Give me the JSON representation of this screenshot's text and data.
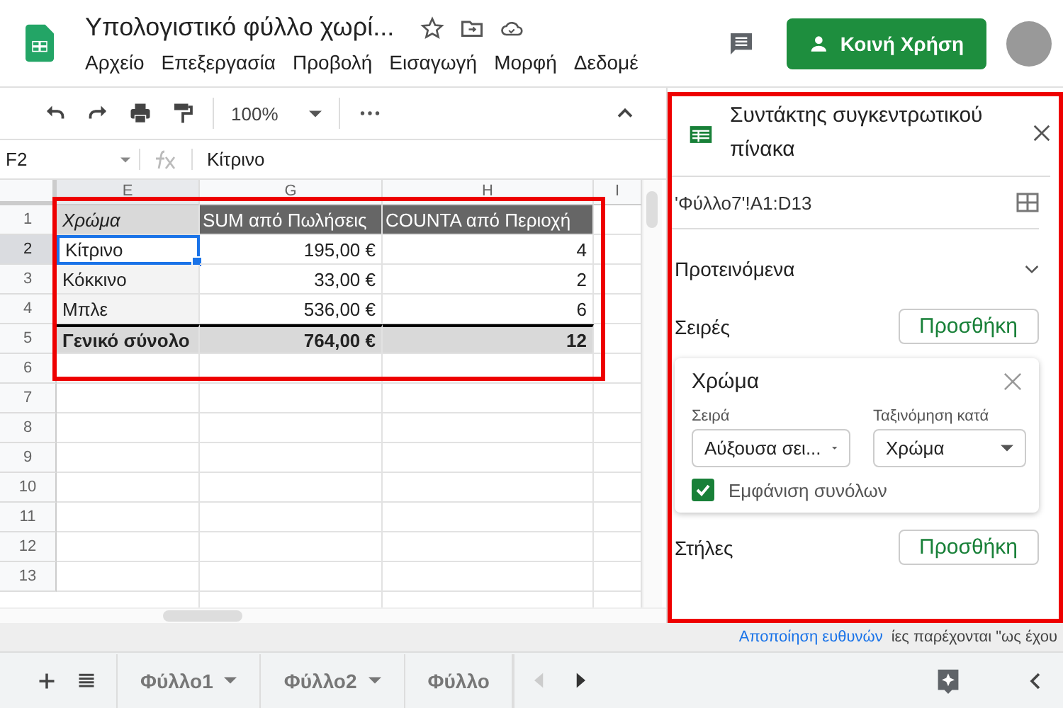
{
  "document": {
    "title": "Υπολογιστικό φύλλο χωρί...",
    "menu": [
      "Αρχείο",
      "Επεξεργασία",
      "Προβολή",
      "Εισαγωγή",
      "Μορφή",
      "Δεδομέ"
    ],
    "share_button": "Κοινή Χρήση"
  },
  "toolbar": {
    "zoom": "100%"
  },
  "formula_bar": {
    "cell": "F2",
    "value": "Κίτρινο"
  },
  "grid": {
    "columns": [
      "E",
      "G",
      "H",
      "I"
    ],
    "rows": [
      {
        "number": "1",
        "kind": "header",
        "selected": false,
        "cells": [
          "Χρώμα",
          "SUM από Πωλήσεις",
          "COUNTA από Περιοχή"
        ]
      },
      {
        "number": "2",
        "kind": "data",
        "selected": true,
        "cells": [
          "Κίτρινο",
          "195,00 €",
          "4"
        ]
      },
      {
        "number": "3",
        "kind": "data",
        "selected": false,
        "cells": [
          "Κόκκινο",
          "33,00 €",
          "2"
        ]
      },
      {
        "number": "4",
        "kind": "data",
        "selected": false,
        "cells": [
          "Μπλε",
          "536,00 €",
          "6"
        ]
      },
      {
        "number": "5",
        "kind": "total",
        "selected": false,
        "cells": [
          "Γενικό σύνολο",
          "764,00 €",
          "12"
        ]
      },
      {
        "number": "6",
        "kind": "empty",
        "selected": false,
        "cells": []
      },
      {
        "number": "7",
        "kind": "empty",
        "selected": false,
        "cells": []
      },
      {
        "number": "8",
        "kind": "empty",
        "selected": false,
        "cells": []
      },
      {
        "number": "9",
        "kind": "empty",
        "selected": false,
        "cells": []
      },
      {
        "number": "10",
        "kind": "empty",
        "selected": false,
        "cells": []
      },
      {
        "number": "11",
        "kind": "empty",
        "selected": false,
        "cells": []
      },
      {
        "number": "12",
        "kind": "empty",
        "selected": false,
        "cells": []
      },
      {
        "number": "13",
        "kind": "empty",
        "selected": false,
        "cells": []
      }
    ]
  },
  "status_bar": {
    "text": "ίες παρέχονται \"ως έχου",
    "link": "Αποποίηση ευθυνών"
  },
  "sheet_tabs": [
    {
      "label": "Φύλλο1",
      "selected": false
    },
    {
      "label": "Φύλλο2",
      "selected": false
    },
    {
      "label": "Φύλλο",
      "selected": false
    }
  ],
  "pivot_editor": {
    "title": "Συντάκτης συγκεντρωτικού πίνακα",
    "range": "'Φύλλο7'!A1:D13",
    "suggested": {
      "label": "Προτεινόμενα",
      "expanded": false
    },
    "rows_section": {
      "label": "Σειρές",
      "add_button": "Προσθήκη"
    },
    "row_card": {
      "title": "Χρώμα",
      "order_label": "Σειρά",
      "order_value": "Αύξουσα σει...",
      "sort_label": "Ταξινόμηση κατά",
      "sort_value": "Χρώμα",
      "totals": {
        "label": "Εμφάνιση συνόλων",
        "checked": true
      }
    },
    "columns_section": {
      "label": "Στήλες",
      "add_button": "Προσθήκη"
    }
  }
}
